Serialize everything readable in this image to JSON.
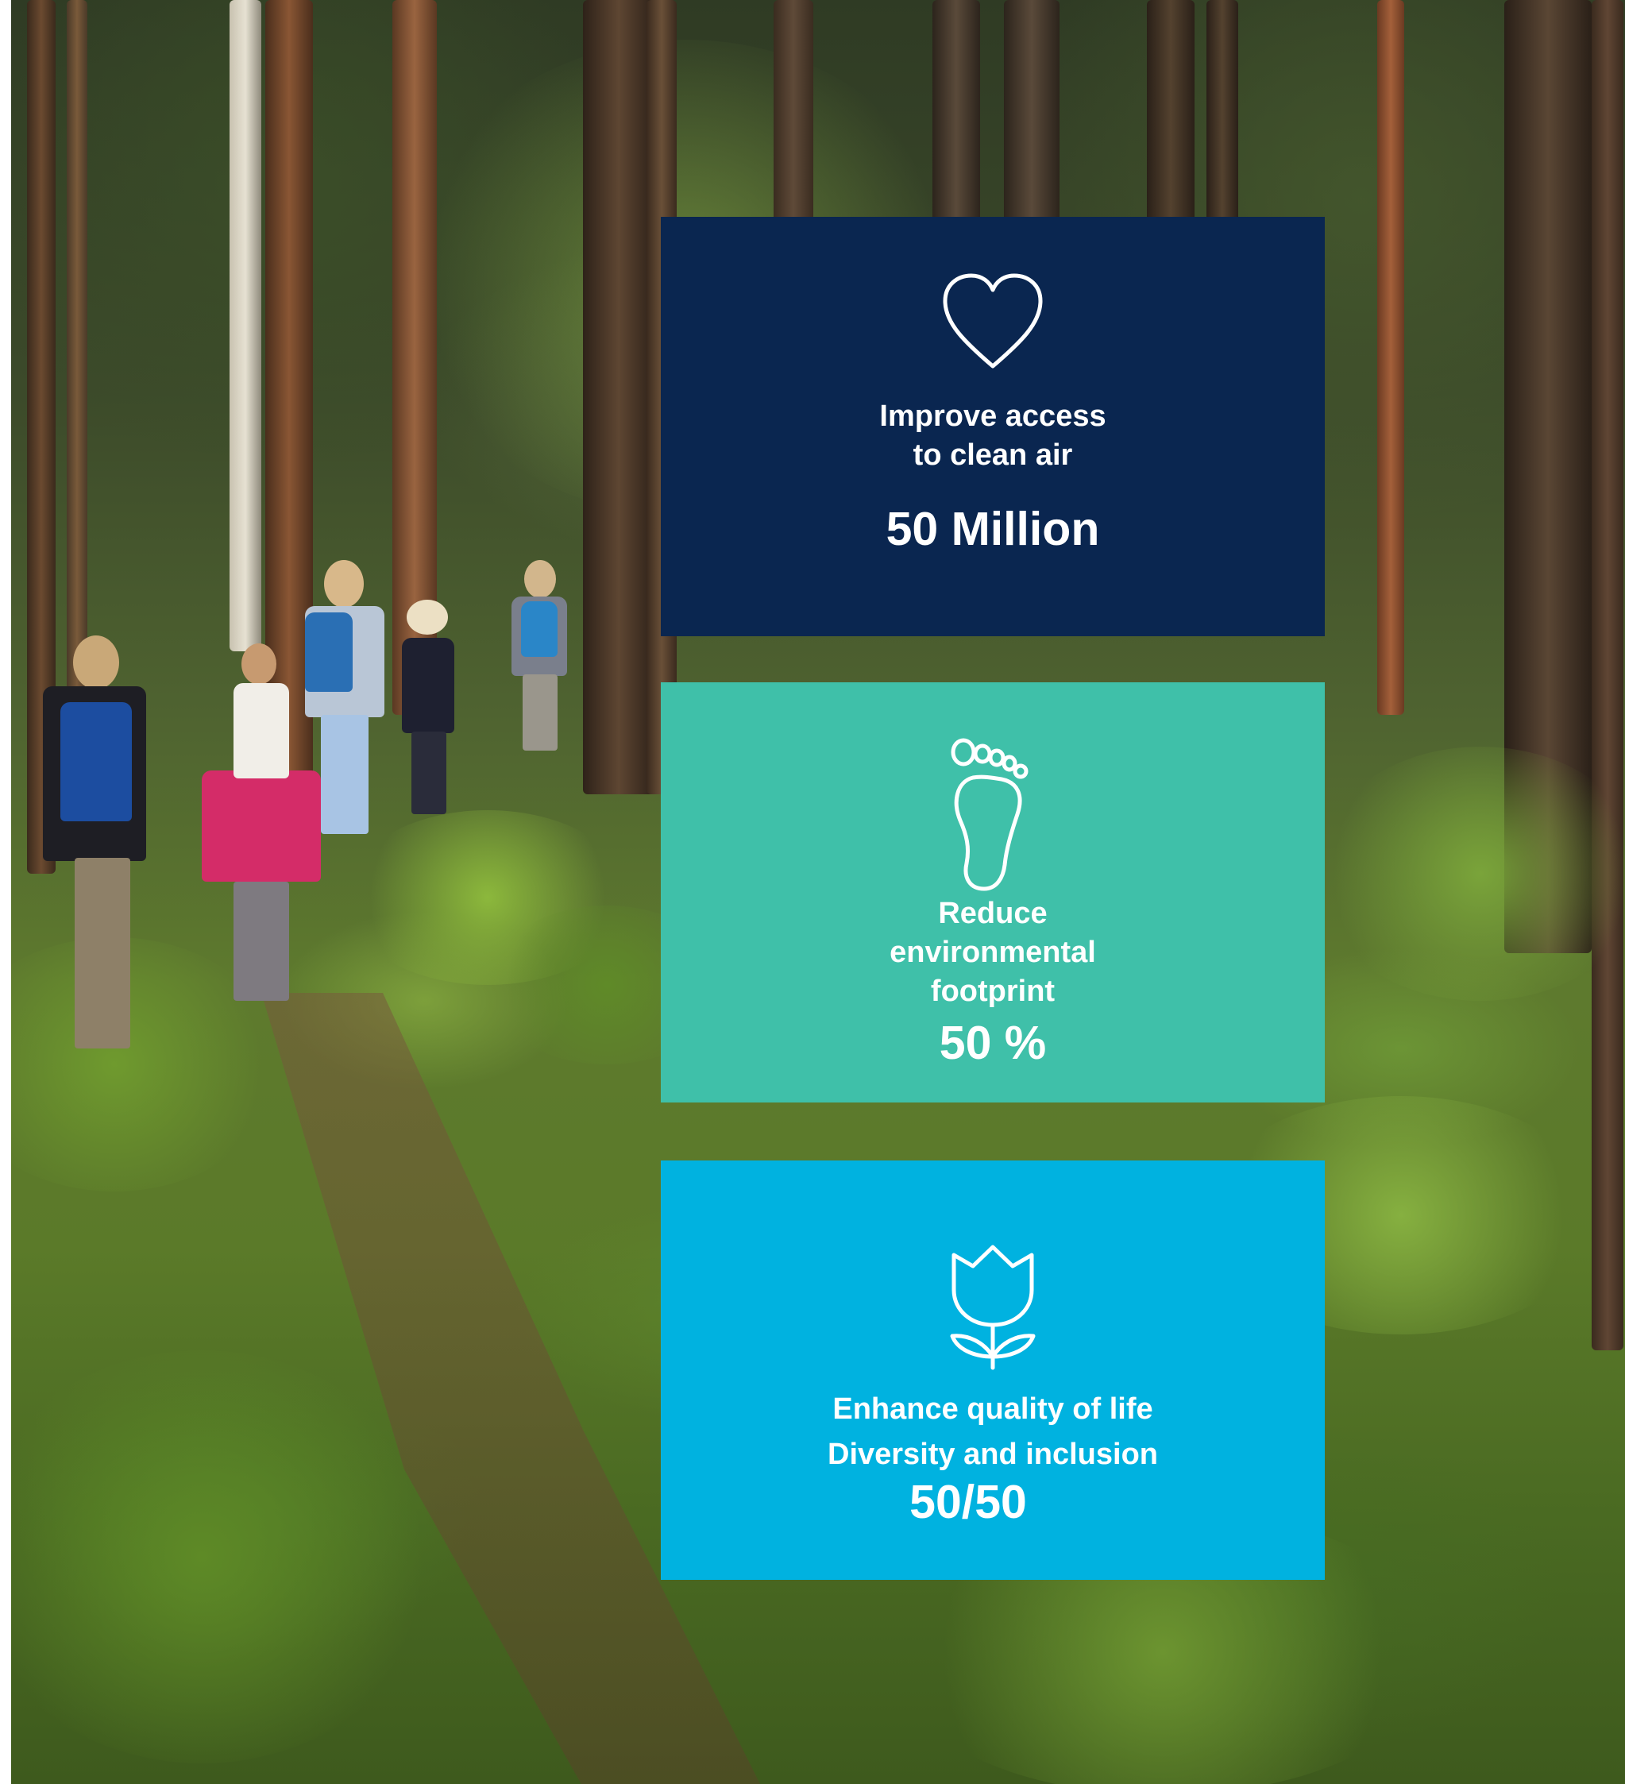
{
  "cards": [
    {
      "icon": "heart-icon",
      "label_lines": [
        "Improve access",
        "to clean air"
      ],
      "value": "50 Million",
      "color": "#0a2650"
    },
    {
      "icon": "footprint-icon",
      "label_lines": [
        "Reduce",
        "environmental",
        "footprint"
      ],
      "value": "50 %",
      "color": "#3fc0a9"
    },
    {
      "icon": "tulip-icon",
      "label_lines": [
        "Enhance quality of life",
        "Diversity and inclusion"
      ],
      "value": "50/50",
      "color": "#00b2e0"
    }
  ]
}
